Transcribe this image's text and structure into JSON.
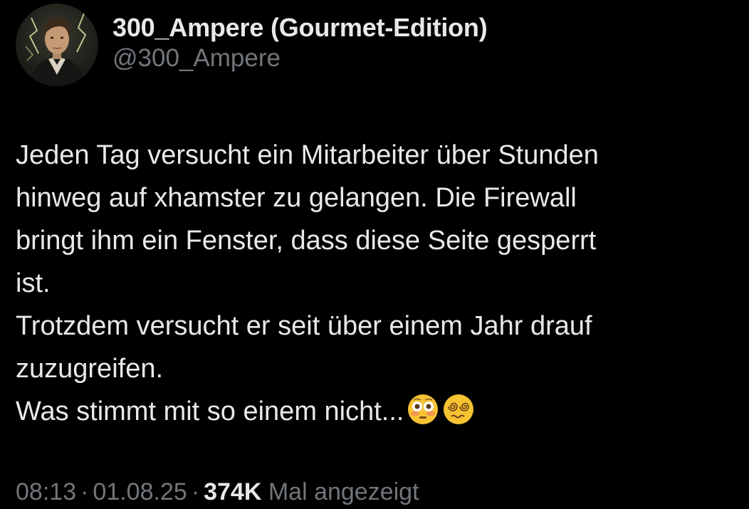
{
  "user": {
    "display_name": "300_Ampere (Gourmet-Edition)",
    "handle": "@300_Ampere"
  },
  "tweet": {
    "lines": [
      "Jeden Tag versucht ein Mitarbeiter über Stunden",
      "hinweg auf xhamster zu gelangen. Die Firewall",
      "bringt ihm ein Fenster, dass diese Seite gesperrt",
      "ist.",
      "Trotzdem versucht er seit über einem Jahr drauf",
      "zuzugreifen.",
      "Was stimmt mit so einem nicht..."
    ],
    "emojis": [
      "flushed-face-emoji",
      "face-with-spiral-eyes-emoji"
    ]
  },
  "meta": {
    "time": "08:13",
    "date": "01.08.25",
    "dot": "·",
    "views_count": "374K",
    "views_label": "Mal angezeigt"
  },
  "colors": {
    "background": "#000000",
    "primary_text": "#e7e9ea",
    "secondary_text": "#71767b"
  }
}
